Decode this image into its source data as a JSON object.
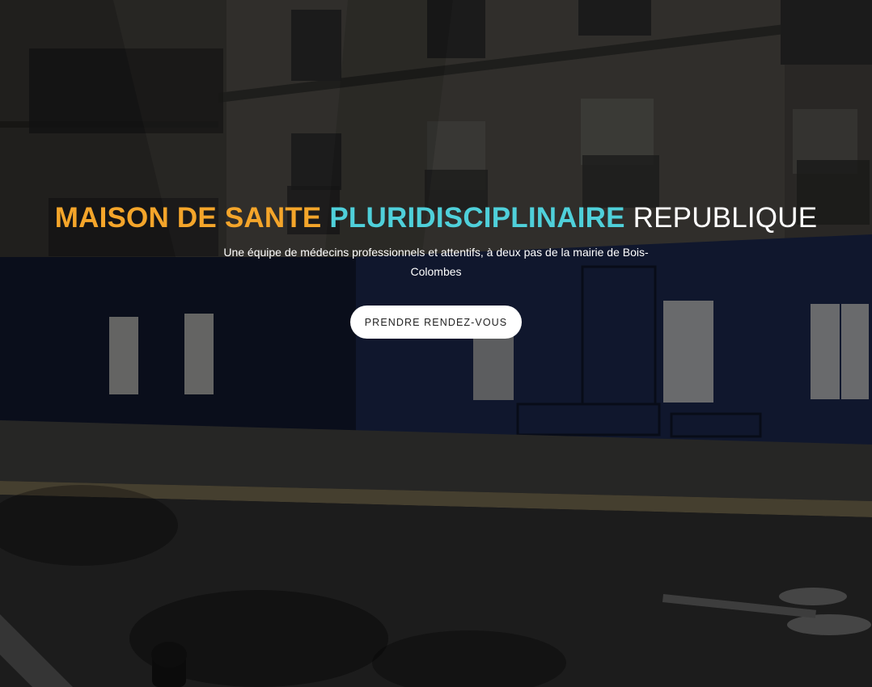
{
  "hero": {
    "title_part1": "MAISON DE SANTE",
    "title_part2": "PLURIDISCIPLINAIRE",
    "title_part3": "REPUBLIQUE",
    "subtitle": "Une équipe de médecins professionnels et attentifs, à deux pas de la mairie de Bois-Colombes",
    "cta_label": "PRENDRE RENDEZ-VOUS"
  },
  "colors": {
    "title_part1": "#f4a52a",
    "title_part2": "#4fd0da",
    "title_part3": "#ffffff",
    "button_bg": "#ffffff",
    "button_text": "#222222"
  }
}
